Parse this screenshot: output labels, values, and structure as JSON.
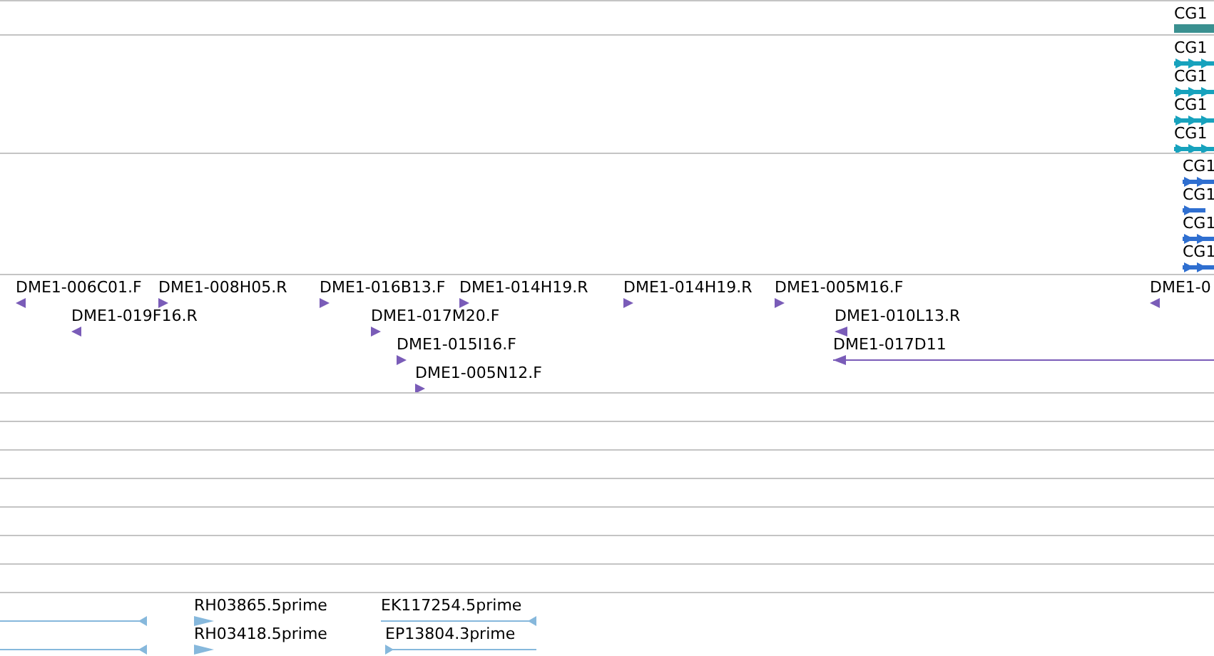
{
  "tracks": [
    {
      "color": "#3a9090",
      "features": [
        {
          "label": "CG1",
          "kind": "bar"
        }
      ]
    },
    {
      "color": "#17a2bd",
      "features": [
        {
          "label": "CG1",
          "kind": "arrowed",
          "forward": true
        },
        {
          "label": "CG1",
          "kind": "arrowed",
          "forward": true
        },
        {
          "label": "CG1",
          "kind": "arrowed",
          "forward": true
        },
        {
          "label": "CG1",
          "kind": "arrowed",
          "forward": true
        }
      ]
    },
    {
      "color": "#2f6fd0",
      "features": [
        {
          "label": "CG1",
          "kind": "arrowed",
          "forward": true
        },
        {
          "label": "CG1",
          "kind": "arrowed",
          "forward": true
        },
        {
          "label": "CG1",
          "kind": "arrowed",
          "forward": true
        },
        {
          "label": "CG1",
          "kind": "arrowed",
          "forward": true
        }
      ]
    },
    {
      "color": "#7a5cb8",
      "features": [
        {
          "label": "DME1-006C01.F",
          "kind": "read",
          "forward": false
        },
        {
          "label": "DME1-008H05.R",
          "kind": "read",
          "forward": true
        },
        {
          "label": "DME1-016B13.F",
          "kind": "read",
          "forward": true
        },
        {
          "label": "DME1-014H19.R",
          "kind": "read",
          "forward": true
        },
        {
          "label": "DME1-014H19.R",
          "kind": "read",
          "forward": true
        },
        {
          "label": "DME1-005M16.F",
          "kind": "read",
          "forward": true
        },
        {
          "label": "DME1-0",
          "kind": "read",
          "forward": false
        },
        {
          "label": "DME1-019F16.R",
          "kind": "read",
          "forward": false
        },
        {
          "label": "DME1-017M20.F",
          "kind": "read",
          "forward": true
        },
        {
          "label": "DME1-010L13.R",
          "kind": "read",
          "forward": false
        },
        {
          "label": "DME1-015I16.F",
          "kind": "read",
          "forward": true
        },
        {
          "label": "DME1-017D11",
          "kind": "span",
          "forward": false
        },
        {
          "label": "DME1-005N12.F",
          "kind": "read",
          "forward": true
        }
      ]
    },
    {
      "color": "#86b8dc",
      "features": [
        {
          "kind": "span",
          "forward": false
        },
        {
          "label": "RH03865.5prime",
          "kind": "read",
          "forward": true
        },
        {
          "label": "EK117254.5prime",
          "kind": "span",
          "forward": false
        },
        {
          "kind": "span",
          "forward": false
        },
        {
          "label": "RH03418.5prime",
          "kind": "read",
          "forward": true
        },
        {
          "label": "EP13804.3prime",
          "kind": "span",
          "forward": true
        }
      ]
    }
  ]
}
